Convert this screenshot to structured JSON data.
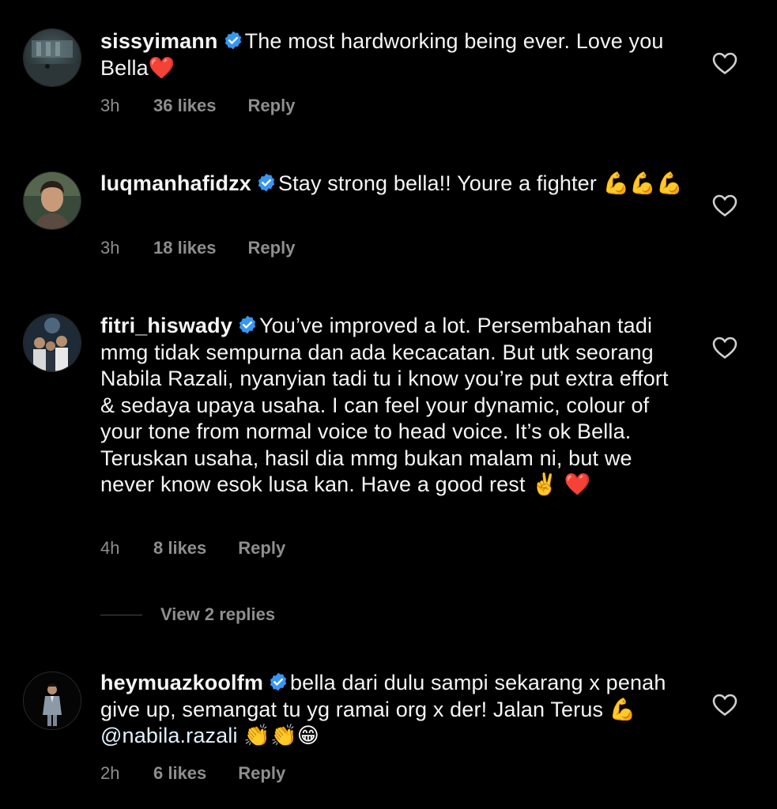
{
  "colors": {
    "background": "#000000",
    "text": "#f5f5f5",
    "muted": "#8e8e8e",
    "verified": "#3897f0"
  },
  "comments": [
    {
      "username": "sissyimann",
      "verified_icon": "verified-badge-icon",
      "text": "The most hardworking being ever. Love you Bella❤️",
      "time": "3h",
      "likes": "36 likes",
      "reply": "Reply"
    },
    {
      "username": "luqmanhafidzx",
      "verified_icon": "verified-badge-icon",
      "text": "Stay strong bella!! Youre a fighter 💪💪💪",
      "time": "3h",
      "likes": "18 likes",
      "reply": "Reply"
    },
    {
      "username": "fitri_hiswady",
      "verified_icon": "verified-badge-icon",
      "text": "You’ve improved a lot. Persembahan tadi mmg tidak sempurna dan ada kecacatan. But utk seorang Nabila Razali, nyanyian tadi tu i know you’re put extra effort & sedaya upaya usaha. I can feel your dynamic, colour of your tone from normal voice to head voice. It’s ok Bella. Teruskan usaha, hasil dia mmg bukan malam ni, but we never know esok lusa kan. Have a good rest ✌️ ❤️",
      "time": "4h",
      "likes": "8 likes",
      "reply": "Reply",
      "view_replies": "View 2 replies"
    },
    {
      "username": "heymuazkoolfm",
      "verified_icon": "verified-badge-icon",
      "text_before_mention": "bella dari dulu sampi sekarang x penah give up, semangat tu yg ramai org x der! Jalan Terus 💪 ",
      "mention": "@nabila.razali",
      "text_after_mention": " 👏👏😁",
      "time": "2h",
      "likes": "6 likes",
      "reply": "Reply"
    }
  ]
}
